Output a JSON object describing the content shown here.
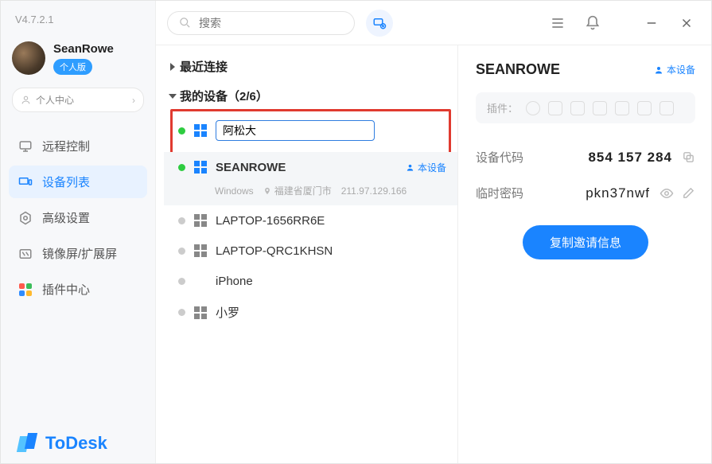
{
  "app": {
    "version": "V4.7.2.1",
    "brand": "ToDesk"
  },
  "profile": {
    "name": "SeanRowe",
    "badge": "个人版",
    "center": "个人中心"
  },
  "search": {
    "placeholder": "搜索"
  },
  "nav": {
    "remote": "远程控制",
    "devices": "设备列表",
    "advanced": "高级设置",
    "mirror": "镜像屏/扩展屏",
    "plugins": "插件中心"
  },
  "groups": {
    "recent": "最近连接",
    "mine_label": "我的设备（2/6）"
  },
  "devices": [
    {
      "name": "阿松大",
      "online": true,
      "os": "windows",
      "editing": true
    },
    {
      "name": "SEANROWE",
      "online": true,
      "os": "windows",
      "this": true,
      "os_label": "Windows",
      "loc": "福建省厦门市",
      "ip": "211.97.129.166"
    },
    {
      "name": "LAPTOP-1656RR6E",
      "online": false,
      "os": "windows"
    },
    {
      "name": "LAPTOP-QRC1KHSN",
      "online": false,
      "os": "windows"
    },
    {
      "name": "iPhone",
      "online": false,
      "os": "apple"
    },
    {
      "name": "小罗",
      "online": false,
      "os": "windows"
    }
  ],
  "this_device_label": "本设备",
  "detail": {
    "title": "SEANROWE",
    "this_label": "本设备",
    "plugins_label": "插件：",
    "code_label": "设备代码",
    "code_value": "854 157 284",
    "pwd_label": "临时密码",
    "pwd_value": "pkn37nwf",
    "copy_btn": "复制邀请信息"
  }
}
